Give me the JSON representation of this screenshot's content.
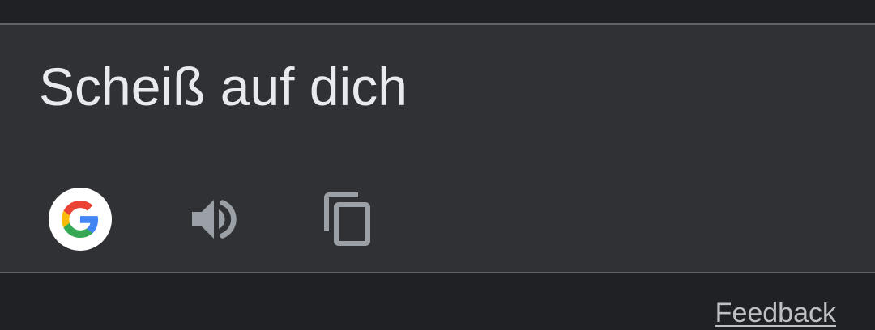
{
  "translation": {
    "text": "Scheiß auf dich"
  },
  "actions": {
    "google_icon": "google-g-icon",
    "speaker_icon": "volume-up-icon",
    "copy_icon": "content-copy-icon"
  },
  "footer": {
    "feedback_label": "Feedback"
  },
  "colors": {
    "background": "#202124",
    "card": "#303134",
    "text": "#e8eaed",
    "icon": "#9aa0a6",
    "link": "#bdc1c6"
  }
}
